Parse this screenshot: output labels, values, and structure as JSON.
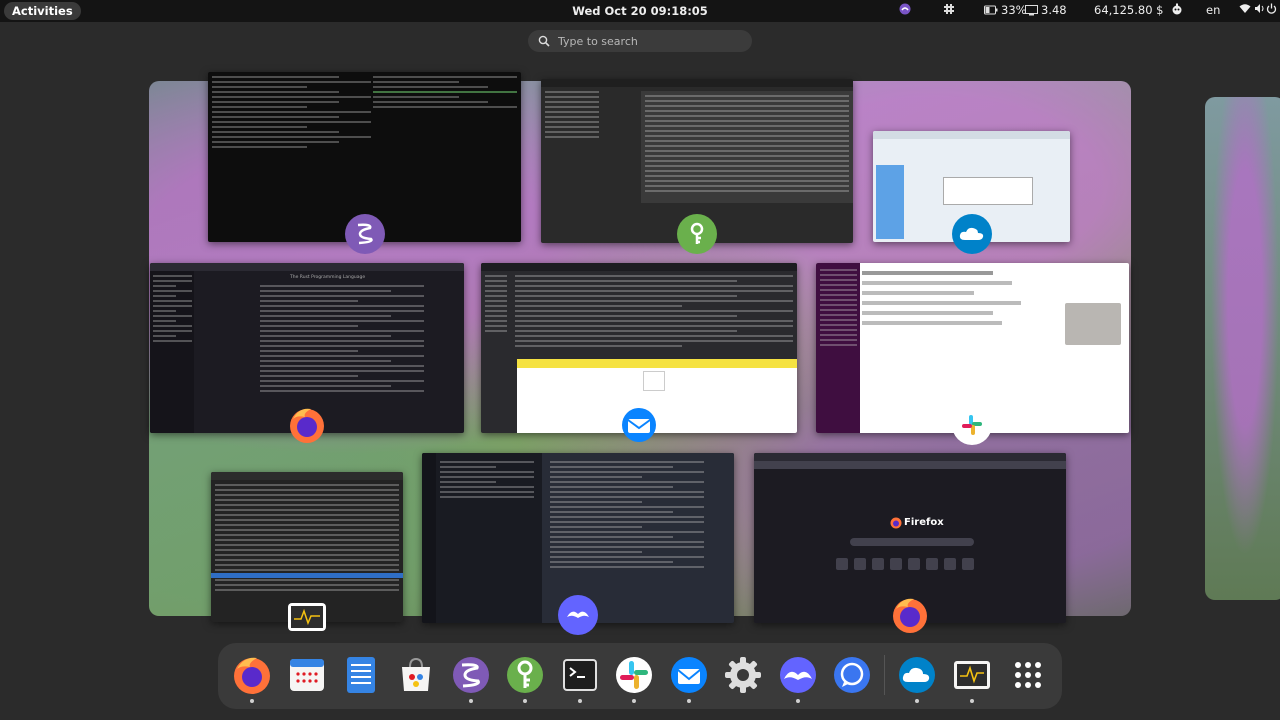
{
  "topbar": {
    "activities_label": "Activities",
    "datetime": "Wed Oct 20  09:18:05",
    "battery": "33%",
    "monitor_value": "3.48",
    "balance": "64,125.80 $",
    "language": "en"
  },
  "search": {
    "placeholder": "Type to search"
  },
  "windows": {
    "editor_doc_title": "The Rust Programming Language",
    "firefox_title": "Firefox"
  },
  "dock": {
    "items": [
      "firefox-icon",
      "calendar-icon",
      "files-icon",
      "software-icon",
      "emacs-icon",
      "keepass-icon",
      "terminal-icon",
      "slack-icon",
      "thunderbird-icon",
      "settings-icon",
      "mastodon-icon",
      "signal-icon",
      "nextcloud-icon",
      "system-monitor-icon",
      "app-grid-icon"
    ]
  },
  "colors": {
    "panel": "#141414",
    "dock_bg": "#3a3a3a",
    "emacs": "#7f5ab6",
    "keepass": "#6ab04c",
    "firefox": "#ff7139",
    "slack_pink": "#e01e5a",
    "nextcloud": "#0082c9"
  }
}
